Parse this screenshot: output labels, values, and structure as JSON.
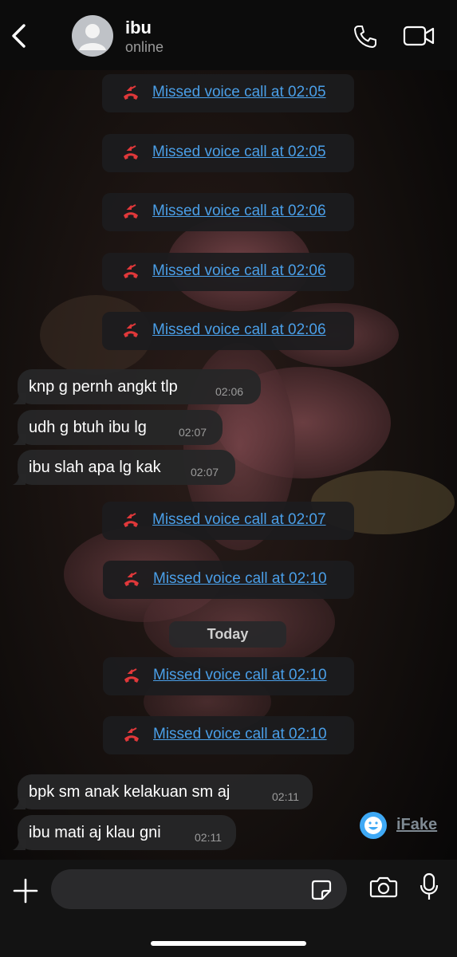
{
  "header": {
    "contact_name": "ibu",
    "status": "online"
  },
  "missed_calls": [
    {
      "label": "Missed voice call at 02:05"
    },
    {
      "label": "Missed voice call at 02:05"
    },
    {
      "label": "Missed voice call at 02:06"
    },
    {
      "label": "Missed voice call at 02:06"
    },
    {
      "label": "Missed voice call at 02:06"
    },
    {
      "label": "Missed voice call at 02:07"
    },
    {
      "label": "Missed voice call at 02:10"
    },
    {
      "label": "Missed voice call at 02:10"
    },
    {
      "label": "Missed voice call at 02:10"
    }
  ],
  "messages": [
    {
      "text": "knp g pernh angkt tlp",
      "time": "02:06"
    },
    {
      "text": "udh g btuh ibu lg",
      "time": "02:07"
    },
    {
      "text": "ibu slah apa lg kak",
      "time": "02:07"
    },
    {
      "text": "bpk sm anak kelakuan sm aj",
      "time": "02:11"
    },
    {
      "text": "ibu mati aj klau gni",
      "time": "02:11"
    }
  ],
  "day_separator": "Today",
  "watermark": "iFake",
  "colors": {
    "link": "#4a9fe8",
    "missed_call_icon": "#e0383a",
    "bubble": "#262628",
    "header": "#0c0c0c"
  },
  "icons": {
    "back": "chevron-left-icon",
    "voice_call": "phone-icon",
    "video_call": "video-camera-icon",
    "missed_call": "missed-call-icon",
    "attach": "plus-icon",
    "sticker": "sticker-icon",
    "camera": "camera-icon",
    "microphone": "microphone-icon"
  }
}
